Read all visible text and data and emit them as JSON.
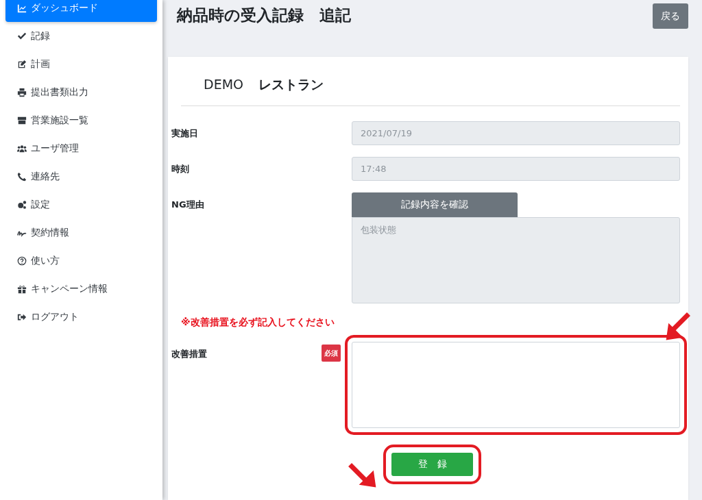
{
  "sidebar": {
    "items": [
      {
        "label": "ダッシュボード",
        "selected": true
      },
      {
        "label": "記録",
        "selected": false
      },
      {
        "label": "計画",
        "selected": false
      },
      {
        "label": "提出書類出力",
        "selected": false
      },
      {
        "label": "営業施設一覧",
        "selected": false
      },
      {
        "label": "ユーザ管理",
        "selected": false
      },
      {
        "label": "連絡先",
        "selected": false
      },
      {
        "label": "設定",
        "selected": false
      },
      {
        "label": "契約情報",
        "selected": false
      },
      {
        "label": "使い方",
        "selected": false
      },
      {
        "label": "キャンペーン情報",
        "selected": false
      },
      {
        "label": "ログアウト",
        "selected": false
      }
    ]
  },
  "page": {
    "title": "納品時の受入記録　追記",
    "back_button": "戻る"
  },
  "form": {
    "facility_code": "DEMO",
    "facility_name": "レストラン",
    "fields": [
      {
        "kind": "input",
        "label": "実施日",
        "value": "2021/07/19",
        "disabled": true
      },
      {
        "kind": "input",
        "label": "時刻",
        "value": "17:48",
        "disabled": true
      },
      {
        "kind": "textarea",
        "label": "NG理由",
        "button": "記録内容を確認",
        "value": "包装状態",
        "disabled": true
      },
      {
        "kind": "notice",
        "text": "※改善措置を必ず記入してください"
      },
      {
        "kind": "textarea",
        "label": "改善措置",
        "required_badge": "必須",
        "disabled": false,
        "highlighted": true
      }
    ],
    "submit": {
      "label": "登　録",
      "highlighted": true
    }
  }
}
